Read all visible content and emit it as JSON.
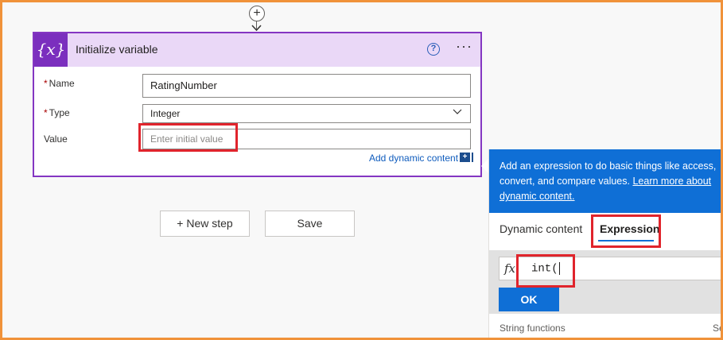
{
  "card": {
    "title": "Initialize variable",
    "icon_glyph": "{x}",
    "help_glyph": "?",
    "more_glyph": "···",
    "fields": {
      "name_label": "Name",
      "name_value": "RatingNumber",
      "type_label": "Type",
      "type_value": "Integer",
      "value_label": "Value",
      "value_placeholder": "Enter initial value",
      "required_marker": "*"
    },
    "add_dynamic_label": "Add dynamic content",
    "dyn_icon_glyph": "+"
  },
  "actions": {
    "new_step_label": "+ New step",
    "save_label": "Save"
  },
  "connector": {
    "plus_glyph": "+"
  },
  "expression_panel": {
    "info_text": "Add an expression to do basic things like access, convert, and compare values.",
    "info_link": "Learn more about dynamic content.",
    "tab_dynamic": "Dynamic content",
    "tab_expression": "Expression",
    "fx_label": "fx",
    "expression_value": "int(",
    "ok_label": "OK",
    "string_functions": "String functions",
    "see_more": "Se"
  },
  "colors": {
    "accent": "#7b2fbe",
    "card_border": "#8436c2",
    "header_bg": "#ead8f7",
    "banner": "#0f6fd6",
    "highlight": "#e0242c",
    "frame": "#f0923a"
  }
}
